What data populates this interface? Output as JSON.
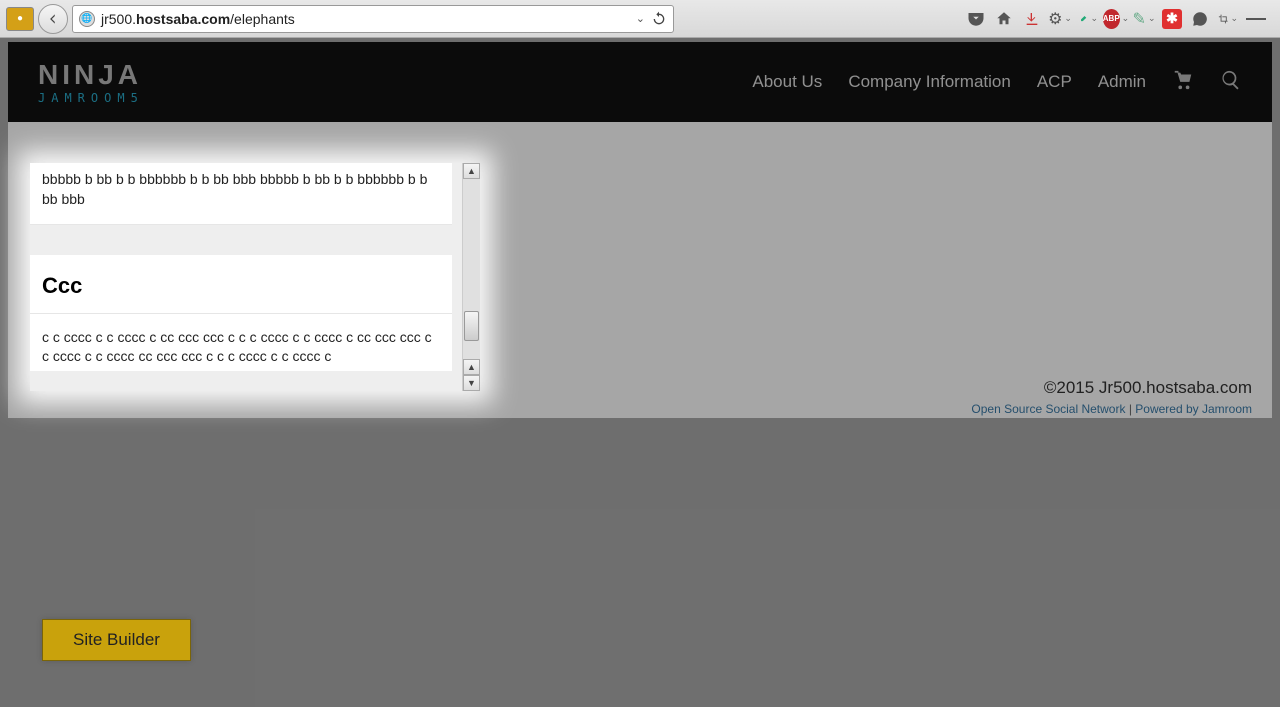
{
  "browser": {
    "url_pre": "jr500.",
    "url_host": "hostsaba.com",
    "url_path": "/elephants"
  },
  "header": {
    "logo_top": "NINJA",
    "logo_sub": "JAMROOM5",
    "nav": {
      "about": "About Us",
      "company": "Company Information",
      "acp": "ACP",
      "admin": "Admin"
    }
  },
  "panel": {
    "b_text": "bbbbb b bb b  b bbbbbb b b bb bbb bbbbb b bb b  b bbbbbb b b bb bbb",
    "ccc_title": "Ccc",
    "c_text": " c c cccc c c cccc c cc ccc ccc c c c cccc c c cccc c cc ccc ccc c c cccc c c cccc cc ccc ccc c c c cccc c c cccc c"
  },
  "footer": {
    "copyright": "©2015 Jr500.hostsaba.com",
    "oss": "Open Source Social Network",
    "sep": " | ",
    "powered": "Powered by Jamroom"
  },
  "site_builder_label": "Site Builder"
}
